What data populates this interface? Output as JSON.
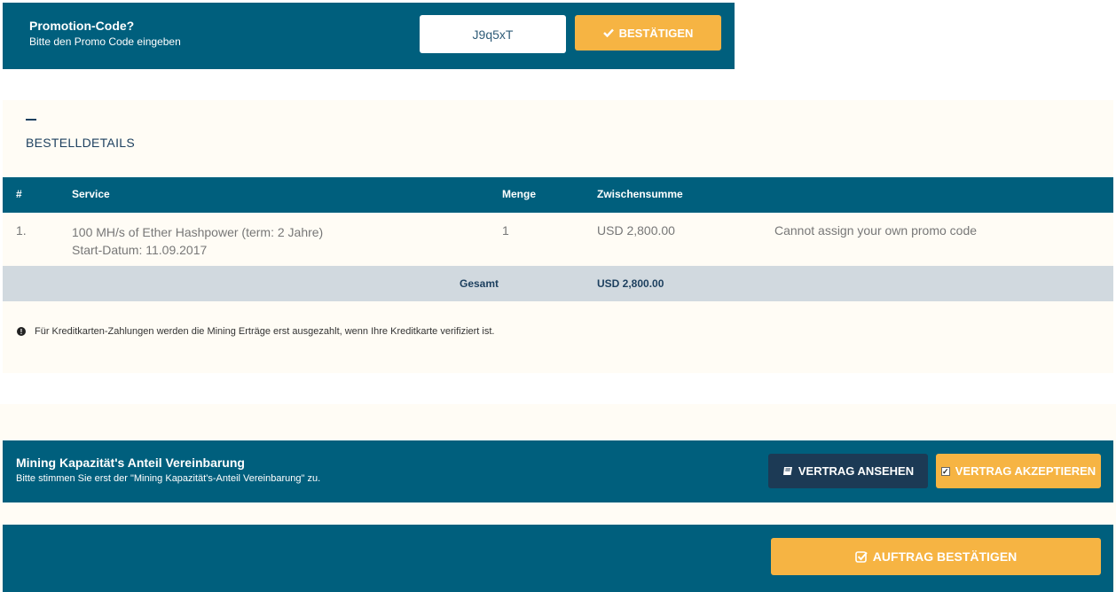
{
  "promo": {
    "title": "Promotion-Code?",
    "subtitle": "Bitte den Promo Code eingeben",
    "code_value": "J9q5xT",
    "confirm_label": "BESTÄTIGEN",
    "confirm_icon": "check-icon"
  },
  "order": {
    "section_title": "BESTELLDETAILS",
    "columns": {
      "num": "#",
      "service": "Service",
      "qty": "Menge",
      "subtotal": "Zwischensumme"
    },
    "rows": [
      {
        "num": "1.",
        "service_line1": "100  MH/s of Ether Hashpower (term: 2 Jahre)",
        "service_line2": "Start-Datum: 11.09.2017",
        "qty": "1",
        "subtotal": "USD 2,800.00",
        "message": "Cannot assign your own promo code"
      }
    ],
    "total_label": "Gesamt",
    "total_value": "USD 2,800.00",
    "note": "Für Kreditkarten-Zahlungen werden die Mining Erträge erst ausgezahlt, wenn Ihre Kreditkarte verifiziert ist."
  },
  "agreement": {
    "title": "Mining Kapazität's Anteil Vereinbarung",
    "subtitle": "Bitte stimmen Sie erst der \"Mining Kapazität's-Anteil Vereinbarung\" zu.",
    "view_label": "VERTRAG ANSEHEN",
    "accept_label": "VERTRAG AKZEPTIEREN"
  },
  "final": {
    "confirm_order_label": "AUFTRAG BESTÄTIGEN"
  },
  "colors": {
    "primary": "#005f7d",
    "accent": "#f6b443",
    "dark_button": "#1c3a55",
    "cream": "#fffcf5",
    "total_row": "#d1d9df"
  }
}
